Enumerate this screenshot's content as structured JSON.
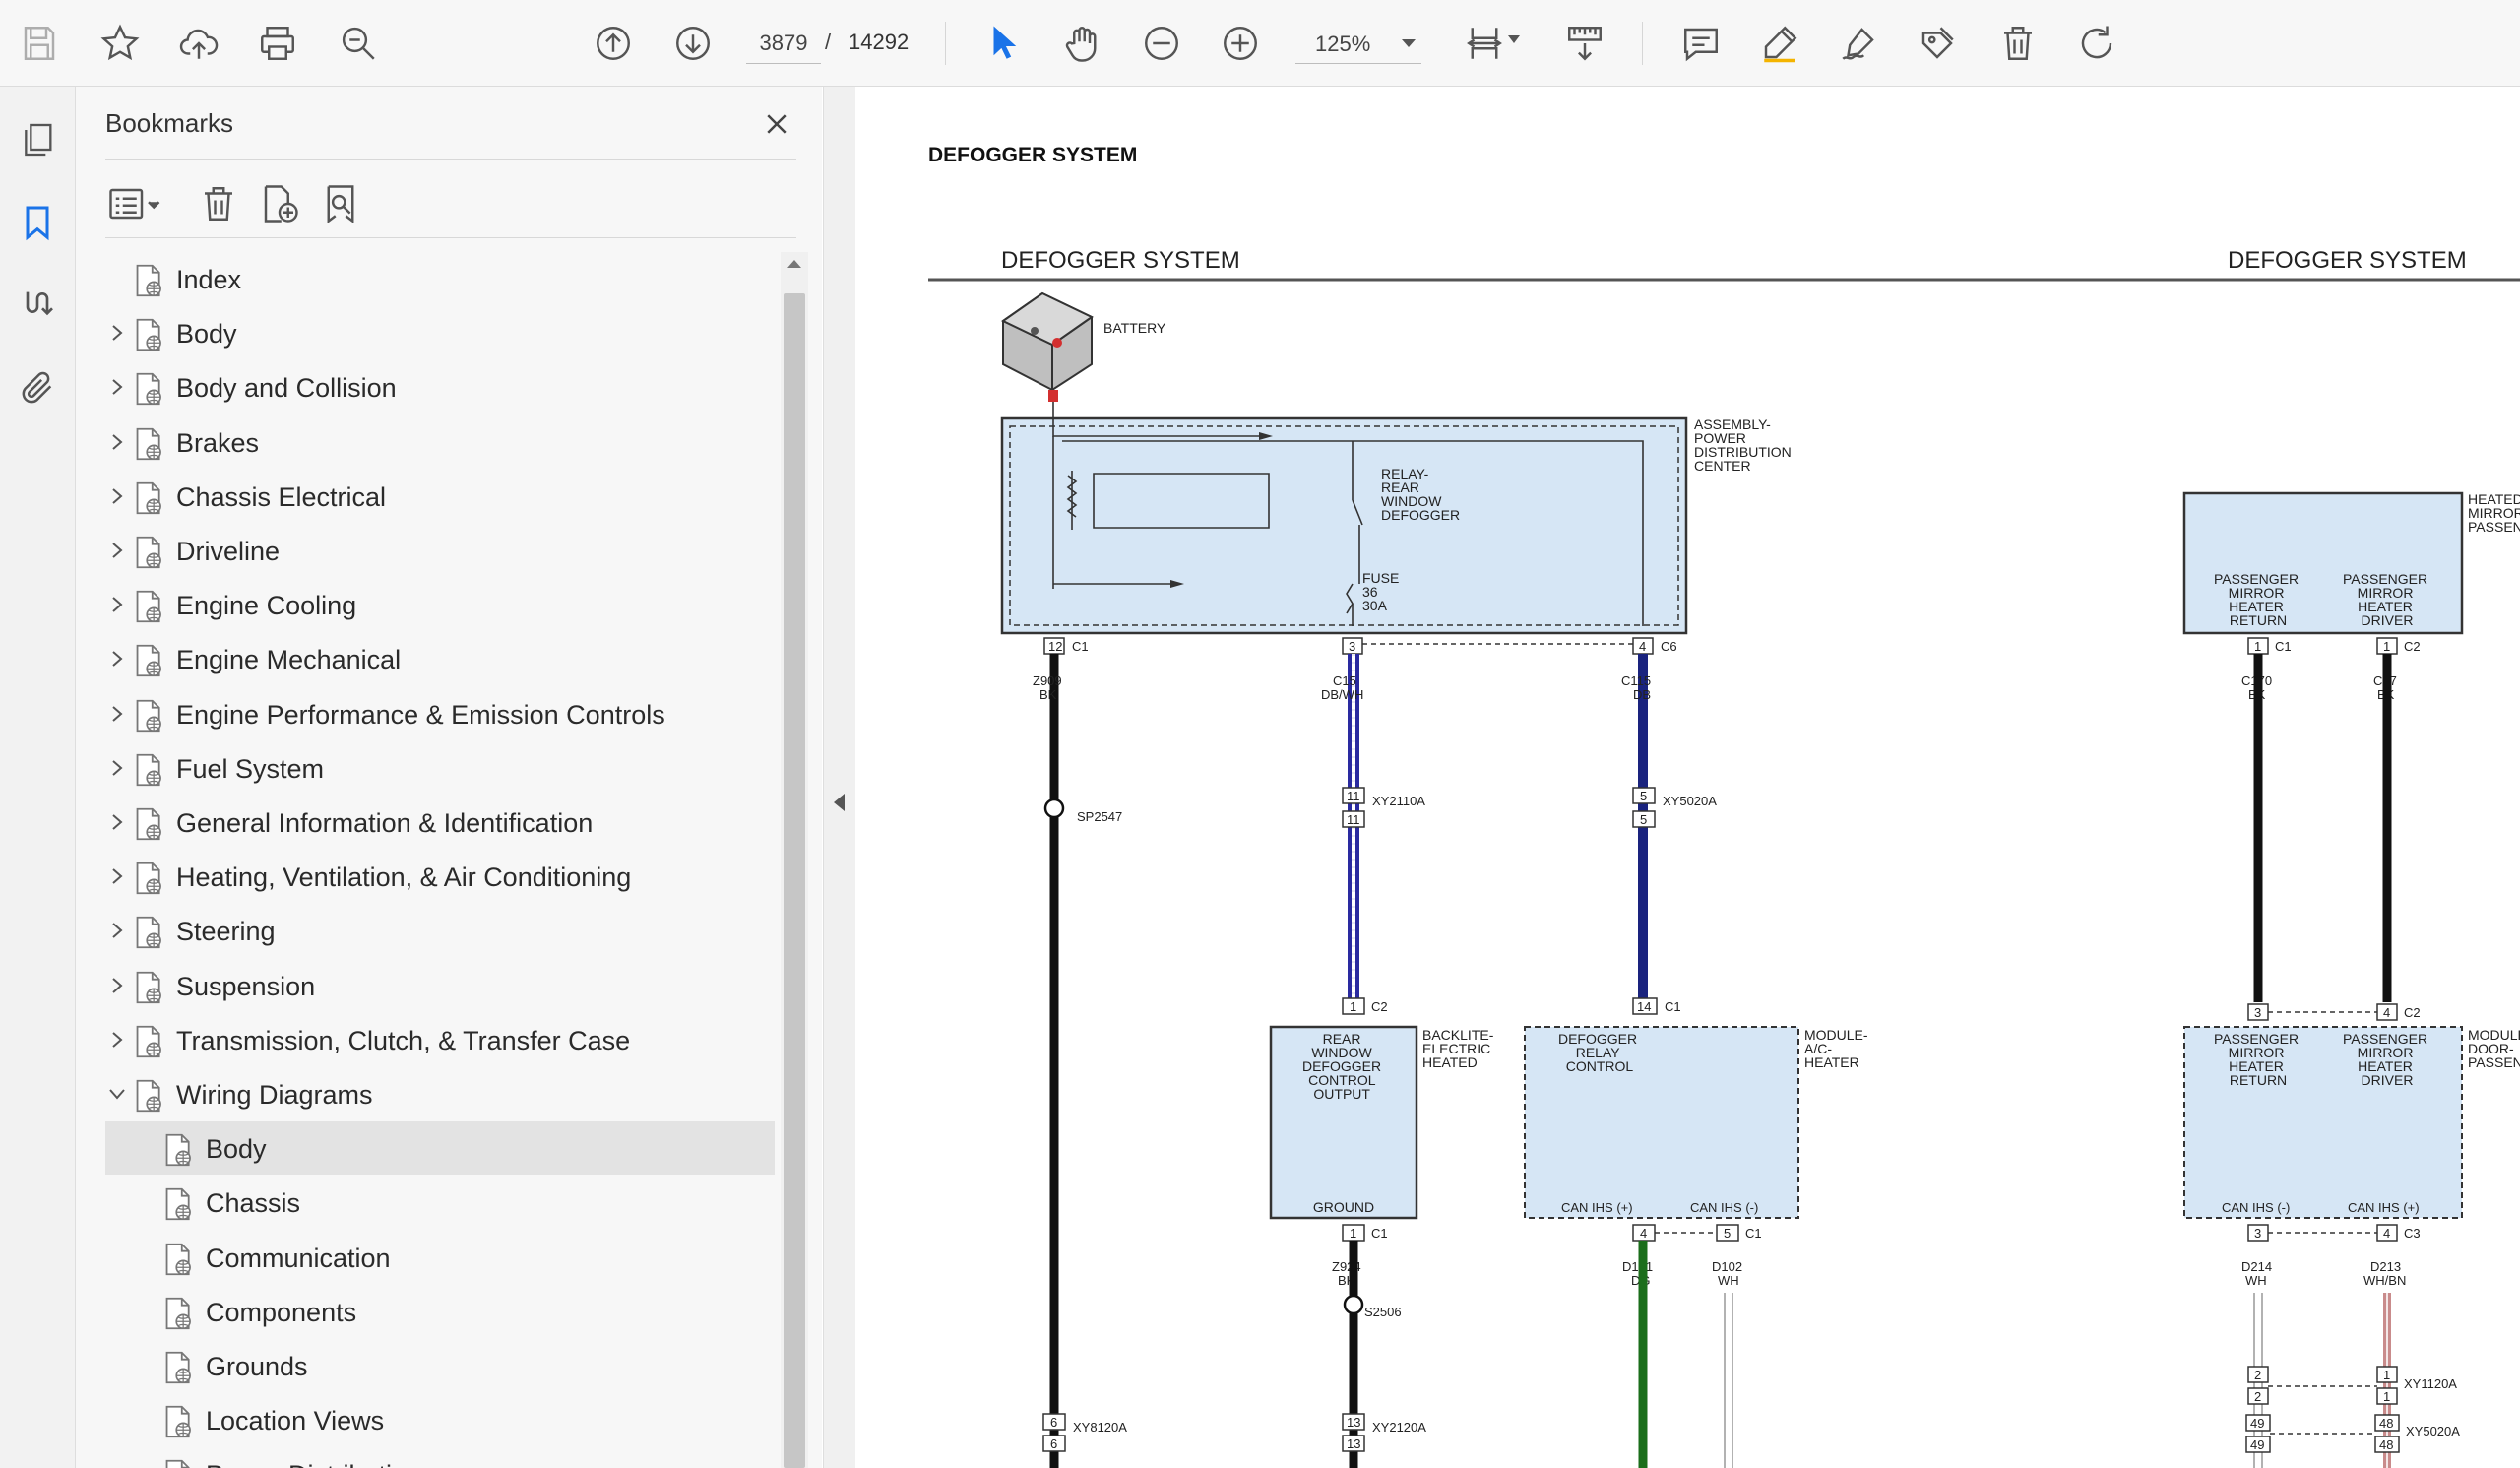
{
  "toolbar": {
    "page_current": "3879",
    "page_separator": "/",
    "page_total": "14292",
    "zoom": "125%",
    "icons": [
      "save-icon",
      "star-icon",
      "cloud-upload-icon",
      "print-icon",
      "zoom-search-icon",
      "page-up-icon",
      "page-down-icon",
      "select-cursor-icon",
      "hand-icon",
      "zoom-out-icon",
      "zoom-in-icon",
      "fit-page-icon",
      "scroll-mode-icon",
      "comment-icon",
      "highlight-icon",
      "sign-icon",
      "stamp-icon",
      "delete-icon",
      "rotate-icon"
    ],
    "accent": "#1a73e8"
  },
  "left_rail": {
    "icons": [
      "pages-icon",
      "bookmark-icon",
      "signature-icon",
      "attachment-icon"
    ],
    "active": "bookmark-icon"
  },
  "bookmarks_panel": {
    "title": "Bookmarks",
    "items": [
      {
        "label": "Index",
        "level": 0,
        "expander": "none"
      },
      {
        "label": "Body",
        "level": 0,
        "expander": "collapsed"
      },
      {
        "label": "Body and Collision",
        "level": 0,
        "expander": "collapsed"
      },
      {
        "label": "Brakes",
        "level": 0,
        "expander": "collapsed"
      },
      {
        "label": "Chassis Electrical",
        "level": 0,
        "expander": "collapsed"
      },
      {
        "label": "Driveline",
        "level": 0,
        "expander": "collapsed"
      },
      {
        "label": "Engine Cooling",
        "level": 0,
        "expander": "collapsed"
      },
      {
        "label": "Engine Mechanical",
        "level": 0,
        "expander": "collapsed"
      },
      {
        "label": "Engine Performance & Emission Controls",
        "level": 0,
        "expander": "collapsed"
      },
      {
        "label": "Fuel System",
        "level": 0,
        "expander": "collapsed"
      },
      {
        "label": "General Information & Identification",
        "level": 0,
        "expander": "collapsed"
      },
      {
        "label": "Heating, Ventilation, & Air Conditioning",
        "level": 0,
        "expander": "collapsed"
      },
      {
        "label": "Steering",
        "level": 0,
        "expander": "collapsed"
      },
      {
        "label": "Suspension",
        "level": 0,
        "expander": "collapsed"
      },
      {
        "label": "Transmission, Clutch, & Transfer Case",
        "level": 0,
        "expander": "collapsed"
      },
      {
        "label": "Wiring Diagrams",
        "level": 0,
        "expander": "expanded"
      },
      {
        "label": "Body",
        "level": 1,
        "expander": "none",
        "selected": true
      },
      {
        "label": "Chassis",
        "level": 1,
        "expander": "none"
      },
      {
        "label": "Communication",
        "level": 1,
        "expander": "none"
      },
      {
        "label": "Components",
        "level": 1,
        "expander": "none"
      },
      {
        "label": "Grounds",
        "level": 1,
        "expander": "none"
      },
      {
        "label": "Location Views",
        "level": 1,
        "expander": "none"
      },
      {
        "label": "Power Distribution",
        "level": 1,
        "expander": "none"
      }
    ]
  },
  "document": {
    "heading": "DEFOGGER SYSTEM",
    "diagram": {
      "title_left": "DEFOGGER SYSTEM",
      "title_right": "DEFOGGER SYSTEM",
      "battery": "BATTERY",
      "pdc": [
        "ASSEMBLY-",
        "POWER",
        "DISTRIBUTION",
        "CENTER"
      ],
      "relay": [
        "RELAY-",
        "REAR",
        "WINDOW",
        "DEFOGGER"
      ],
      "fuse": [
        "FUSE",
        "36",
        "30A"
      ],
      "pin12": "12",
      "c1": "C1",
      "pin3": "3",
      "pin4": "4",
      "c6": "C6",
      "wire1": [
        "Z909",
        "BK"
      ],
      "wire2": [
        "C15",
        "DB/WH"
      ],
      "wire3": [
        "C115",
        "DB"
      ],
      "sp2547": "SP2547",
      "xy2110a": "XY2110A",
      "xy5020a": "XY5020A",
      "p11": "11",
      "p5": "5",
      "p1": "1",
      "c2": "C2",
      "p14": "14",
      "backlite": [
        "BACKLITE-",
        "ELECTRIC",
        "HEATED"
      ],
      "backlite_box": [
        "REAR",
        "WINDOW",
        "DEFOGGER",
        "CONTROL",
        "OUTPUT"
      ],
      "ground": "GROUND",
      "hvac_label": [
        "MODULE-",
        "A/C-",
        "HEATER"
      ],
      "relay_control": [
        "DEFOGGER",
        "RELAY",
        "CONTROL"
      ],
      "can_pos": "CAN IHS (+)",
      "can_neg": "CAN IHS (-)",
      "wire_z924": [
        "Z924",
        "BK"
      ],
      "wire_d101": [
        "D101",
        "DG"
      ],
      "wire_d102": [
        "D102",
        "WH"
      ],
      "s2506": "S2506",
      "p13": "13",
      "xy2120a": "XY2120A",
      "p6": "6",
      "xy8120a": "XY8120A",
      "mirror_label": [
        "HEATED",
        "MIRROR",
        "PASSENGER"
      ],
      "mirror_ret": [
        "PASSENGER",
        "MIRROR",
        "HEATER",
        "RETURN"
      ],
      "mirror_drv": [
        "PASSENGER",
        "MIRROR",
        "HEATER",
        "DRIVER"
      ],
      "wire_c170": [
        "C170",
        "BK"
      ],
      "wire_c17": [
        "C17",
        "BK"
      ],
      "door_label": [
        "MODULE-",
        "DOOR-",
        "PASSENGER"
      ],
      "wire_d214": [
        "D214",
        "WH"
      ],
      "wire_d213": [
        "D213",
        "WH/BN"
      ],
      "c3": "C3",
      "p2": "2",
      "xy1120a": "XY1120A",
      "p49": "49",
      "p48": "48"
    }
  }
}
